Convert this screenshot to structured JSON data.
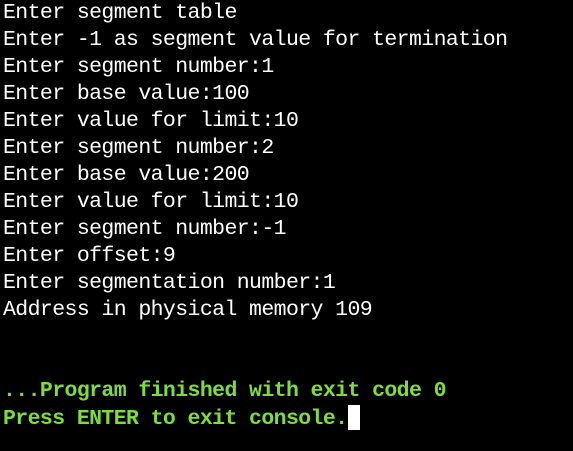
{
  "console": {
    "output_lines": [
      "Enter segment table",
      "Enter -1 as segment value for termination",
      "Enter segment number:1",
      "Enter base value:100",
      "Enter value for limit:10",
      "Enter segment number:2",
      "Enter base value:200",
      "Enter value for limit:10",
      "Enter segment number:-1",
      "Enter offset:9",
      "Enter segmentation number:1",
      "Address in physical memory 109"
    ],
    "finished_message": "...Program finished with exit code 0",
    "exit_prompt": "Press ENTER to exit console."
  },
  "colors": {
    "background": "#000000",
    "text": "#ffffff",
    "status_text": "#7cdd3b"
  }
}
